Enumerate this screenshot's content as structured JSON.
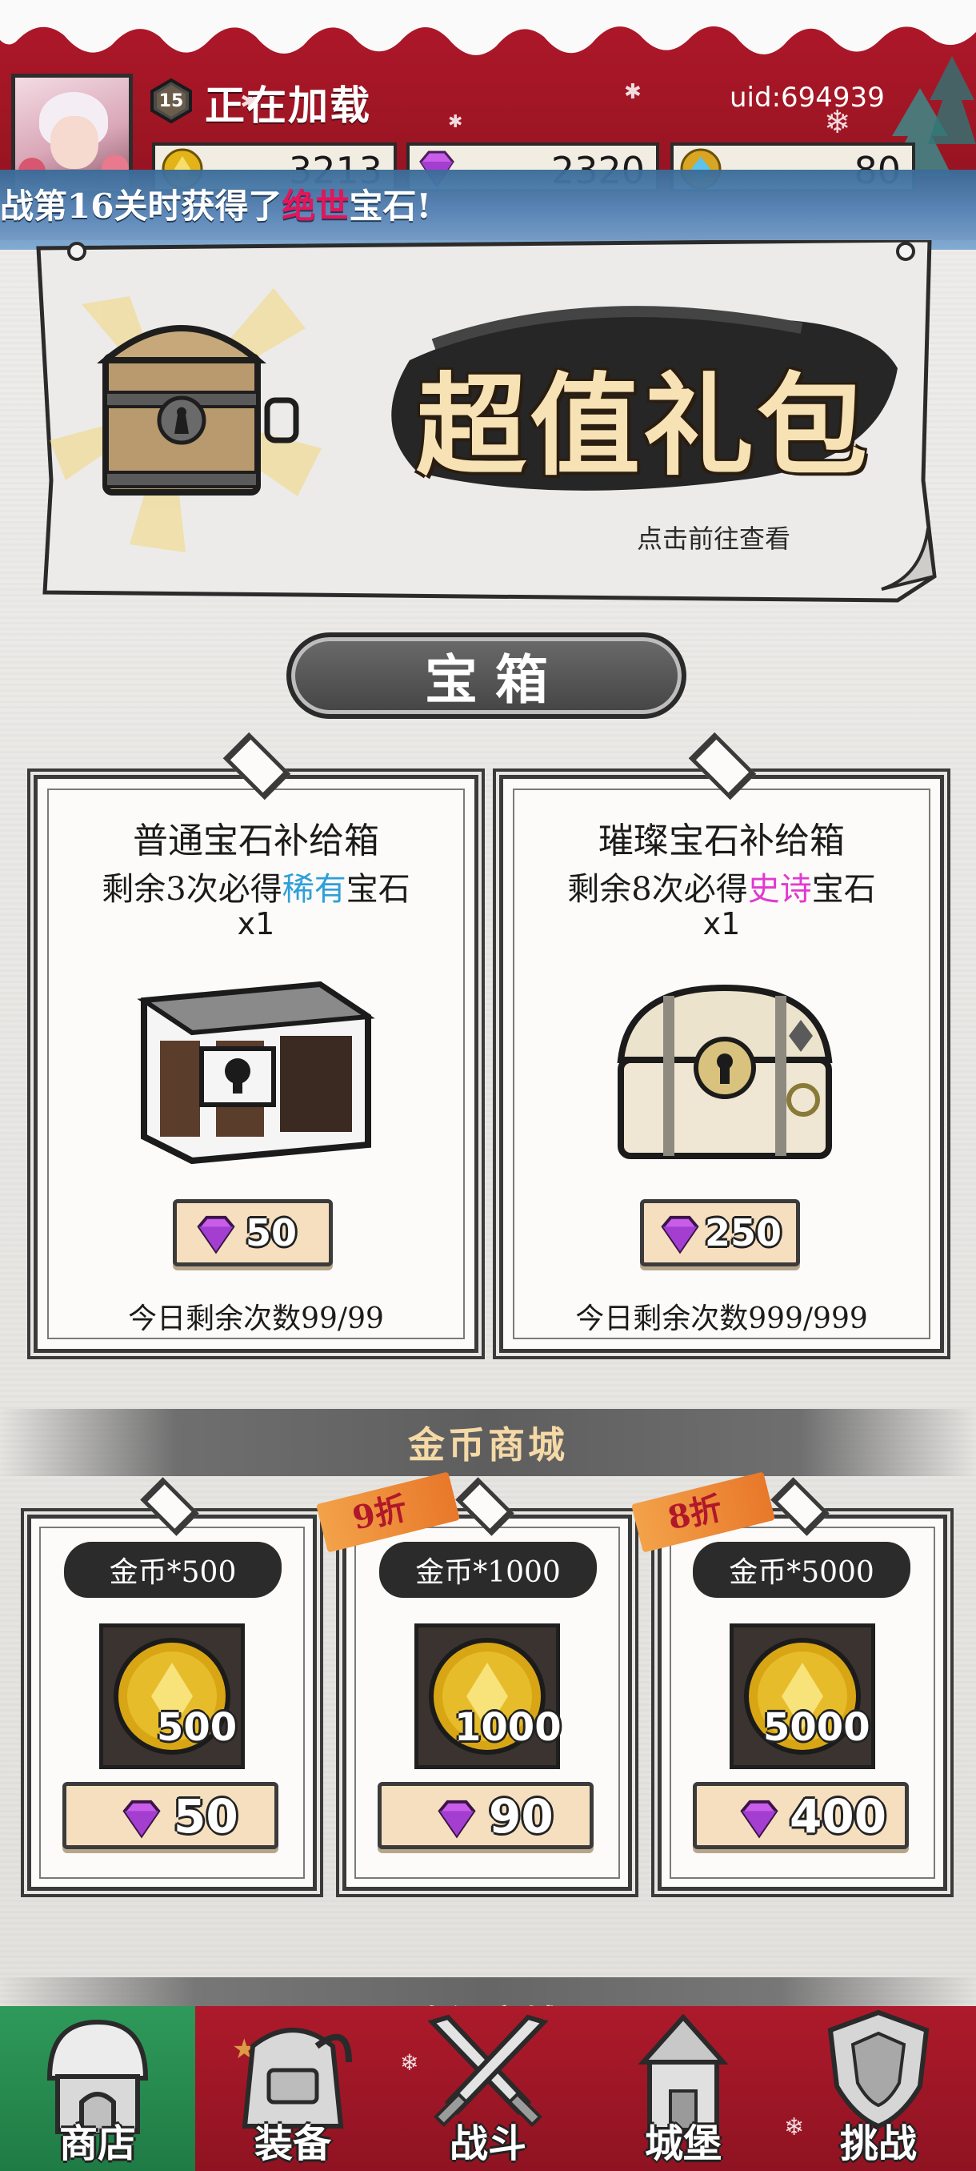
{
  "header": {
    "level": "15",
    "player_name": "正在加载",
    "uid": "uid:694939",
    "resources": [
      {
        "icon": "gold-coin-icon",
        "value": "3213"
      },
      {
        "icon": "purple-gem-icon",
        "value": "2320"
      },
      {
        "icon": "blue-crystal-coin-icon",
        "value": "80"
      }
    ]
  },
  "ticker": {
    "prefix": "战第16关时获得了",
    "highlight": "绝世",
    "suffix": "宝石!"
  },
  "banner": {
    "title": "超值礼包",
    "link_text": "点击前往查看"
  },
  "chest_section": {
    "title": "宝箱",
    "cards": [
      {
        "title": "普通宝石补给箱",
        "sub_prefix": "剩余3次必得",
        "sub_rarity": "稀有",
        "sub_suffix": "宝石",
        "qty": "x1",
        "price": "50",
        "remaining": "今日剩余次数99/99"
      },
      {
        "title": "璀璨宝石补给箱",
        "sub_prefix": "剩余8次必得",
        "sub_rarity": "史诗",
        "sub_suffix": "宝石",
        "qty": "x1",
        "price": "250",
        "remaining": "今日剩余次数999/999"
      }
    ]
  },
  "gold_shop": {
    "title": "金币商城",
    "items": [
      {
        "label": "金币*500",
        "amount": "500",
        "price": "50",
        "discount": ""
      },
      {
        "label": "金币*1000",
        "amount": "1000",
        "price": "90",
        "discount": "9折"
      },
      {
        "label": "金币*5000",
        "amount": "5000",
        "price": "400",
        "discount": "8折"
      }
    ]
  },
  "resource_shop": {
    "title": "资源商城"
  },
  "nav": [
    {
      "label": "商店",
      "icon": "shop-hut-icon",
      "active": true
    },
    {
      "label": "装备",
      "icon": "backpack-icon",
      "active": false
    },
    {
      "label": "战斗",
      "icon": "crossed-swords-icon",
      "active": false
    },
    {
      "label": "城堡",
      "icon": "castle-tower-icon",
      "active": false
    },
    {
      "label": "挑战",
      "icon": "shield-crest-icon",
      "active": false
    }
  ],
  "colors": {
    "header_red": "#b0182a",
    "ticker_blue": "#4a7cab",
    "rare_blue": "#2e9fd9",
    "epic_pink": "#e03ad0",
    "price_button": "#f6dfbe",
    "nav_active_green": "#2e9a5a"
  }
}
